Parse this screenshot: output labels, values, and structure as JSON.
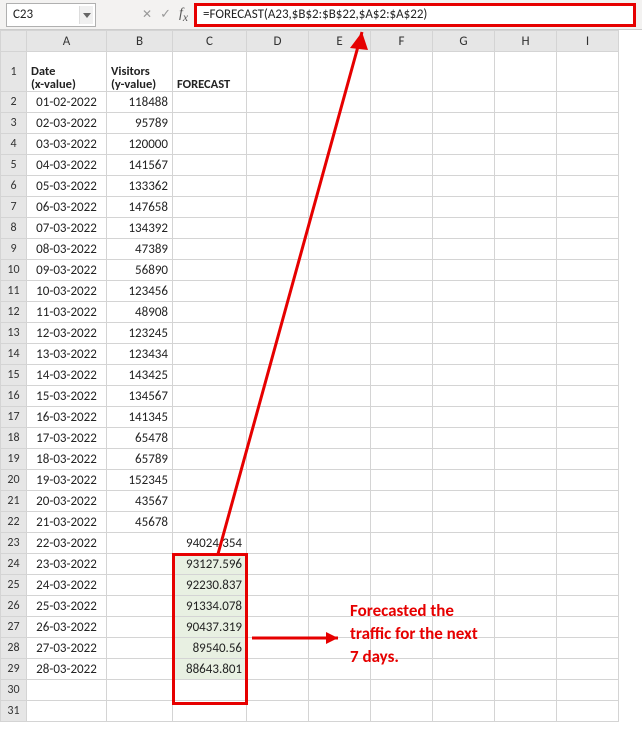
{
  "nameBox": "C23",
  "formula": "=FORECAST(A23,$B$2:$B$22,$A$2:$A$22)",
  "columns": [
    "A",
    "B",
    "C",
    "D",
    "E",
    "F",
    "G",
    "H",
    "I"
  ],
  "header": {
    "A1a": "Date",
    "A1b": "(x-value)",
    "B1a": "Visitors",
    "B1b": "(y-value)",
    "C1": "FORECAST"
  },
  "rows": [
    {
      "r": 2,
      "date": "01-02-2022",
      "vis": "118488",
      "fc": ""
    },
    {
      "r": 3,
      "date": "02-03-2022",
      "vis": "95789",
      "fc": ""
    },
    {
      "r": 4,
      "date": "03-03-2022",
      "vis": "120000",
      "fc": ""
    },
    {
      "r": 5,
      "date": "04-03-2022",
      "vis": "141567",
      "fc": ""
    },
    {
      "r": 6,
      "date": "05-03-2022",
      "vis": "133362",
      "fc": ""
    },
    {
      "r": 7,
      "date": "06-03-2022",
      "vis": "147658",
      "fc": ""
    },
    {
      "r": 8,
      "date": "07-03-2022",
      "vis": "134392",
      "fc": ""
    },
    {
      "r": 9,
      "date": "08-03-2022",
      "vis": "47389",
      "fc": ""
    },
    {
      "r": 10,
      "date": "09-03-2022",
      "vis": "56890",
      "fc": ""
    },
    {
      "r": 11,
      "date": "10-03-2022",
      "vis": "123456",
      "fc": ""
    },
    {
      "r": 12,
      "date": "11-03-2022",
      "vis": "48908",
      "fc": ""
    },
    {
      "r": 13,
      "date": "12-03-2022",
      "vis": "123245",
      "fc": ""
    },
    {
      "r": 14,
      "date": "13-03-2022",
      "vis": "123434",
      "fc": ""
    },
    {
      "r": 15,
      "date": "14-03-2022",
      "vis": "143425",
      "fc": ""
    },
    {
      "r": 16,
      "date": "15-03-2022",
      "vis": "134567",
      "fc": ""
    },
    {
      "r": 17,
      "date": "16-03-2022",
      "vis": "141345",
      "fc": ""
    },
    {
      "r": 18,
      "date": "17-03-2022",
      "vis": "65478",
      "fc": ""
    },
    {
      "r": 19,
      "date": "18-03-2022",
      "vis": "65789",
      "fc": ""
    },
    {
      "r": 20,
      "date": "19-03-2022",
      "vis": "152345",
      "fc": ""
    },
    {
      "r": 21,
      "date": "20-03-2022",
      "vis": "43567",
      "fc": ""
    },
    {
      "r": 22,
      "date": "21-03-2022",
      "vis": "45678",
      "fc": ""
    },
    {
      "r": 23,
      "date": "22-03-2022",
      "vis": "",
      "fc": "94024.354"
    },
    {
      "r": 24,
      "date": "23-03-2022",
      "vis": "",
      "fc": "93127.596"
    },
    {
      "r": 25,
      "date": "24-03-2022",
      "vis": "",
      "fc": "92230.837"
    },
    {
      "r": 26,
      "date": "25-03-2022",
      "vis": "",
      "fc": "91334.078"
    },
    {
      "r": 27,
      "date": "26-03-2022",
      "vis": "",
      "fc": "90437.319"
    },
    {
      "r": 28,
      "date": "27-03-2022",
      "vis": "",
      "fc": "89540.56"
    },
    {
      "r": 29,
      "date": "28-03-2022",
      "vis": "",
      "fc": "88643.801"
    }
  ],
  "emptyRows": [
    30,
    31
  ],
  "annotation": {
    "l1": "Forecasted the",
    "l2": "traffic for the next",
    "l3": "7 days."
  }
}
